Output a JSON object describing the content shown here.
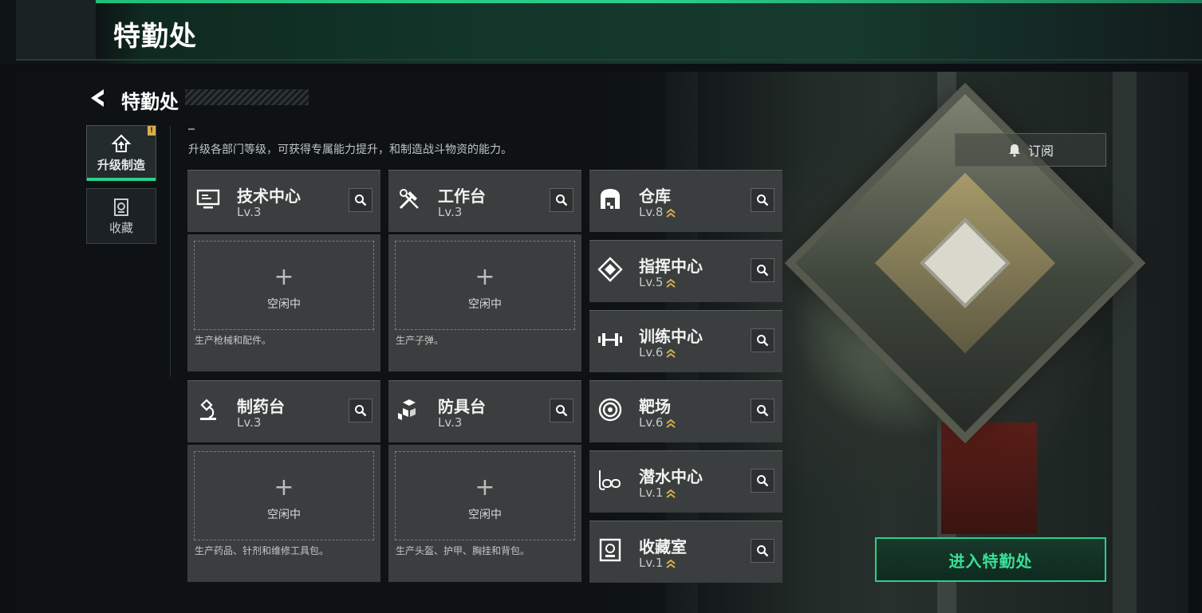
{
  "banner": {
    "title": "特勤处"
  },
  "header": {
    "title": "特勤处"
  },
  "tabs": [
    {
      "label": "升级制造",
      "icon": "upgrade-icon",
      "active": true
    },
    {
      "label": "收藏",
      "icon": "collection-icon",
      "active": false
    }
  ],
  "description": "升级各部门等级，可获得专属能力提升，和制造战斗物资的能力。",
  "subscribe": {
    "label": "订阅",
    "icon": "bell-icon"
  },
  "production_buildings": [
    {
      "name": "技术中心",
      "level": "Lv.3",
      "icon": "monitor-icon",
      "status": "空闲中",
      "desc": "生产枪械和配件。"
    },
    {
      "name": "工作台",
      "level": "Lv.3",
      "icon": "tools-icon",
      "status": "空闲中",
      "desc": "生产子弹。"
    },
    {
      "name": "制药台",
      "level": "Lv.3",
      "icon": "microscope-icon",
      "status": "空闲中",
      "desc": "生产药品、针剂和维修工具包。"
    },
    {
      "name": "防具台",
      "level": "Lv.3",
      "icon": "armor-blocks-icon",
      "status": "空闲中",
      "desc": "生产头盔、护甲、胸挂和背包。"
    }
  ],
  "facilities": [
    {
      "name": "仓库",
      "level": "Lv.8",
      "icon": "warehouse-icon",
      "upgradable": true
    },
    {
      "name": "指挥中心",
      "level": "Lv.5",
      "icon": "command-icon",
      "upgradable": true
    },
    {
      "name": "训练中心",
      "level": "Lv.6",
      "icon": "dumbbell-icon",
      "upgradable": true
    },
    {
      "name": "靶场",
      "level": "Lv.6",
      "icon": "target-icon",
      "upgradable": true
    },
    {
      "name": "潜水中心",
      "level": "Lv.1",
      "icon": "diving-mask-icon",
      "upgradable": true
    },
    {
      "name": "收藏室",
      "level": "Lv.1",
      "icon": "vault-icon",
      "upgradable": true
    }
  ],
  "enter_button": {
    "label": "进入特勤处"
  },
  "colors": {
    "accent": "#2ad08a",
    "card": "#3a3e3e",
    "background": "#0e1214",
    "upgrade_chevron": "#d8b04a"
  }
}
